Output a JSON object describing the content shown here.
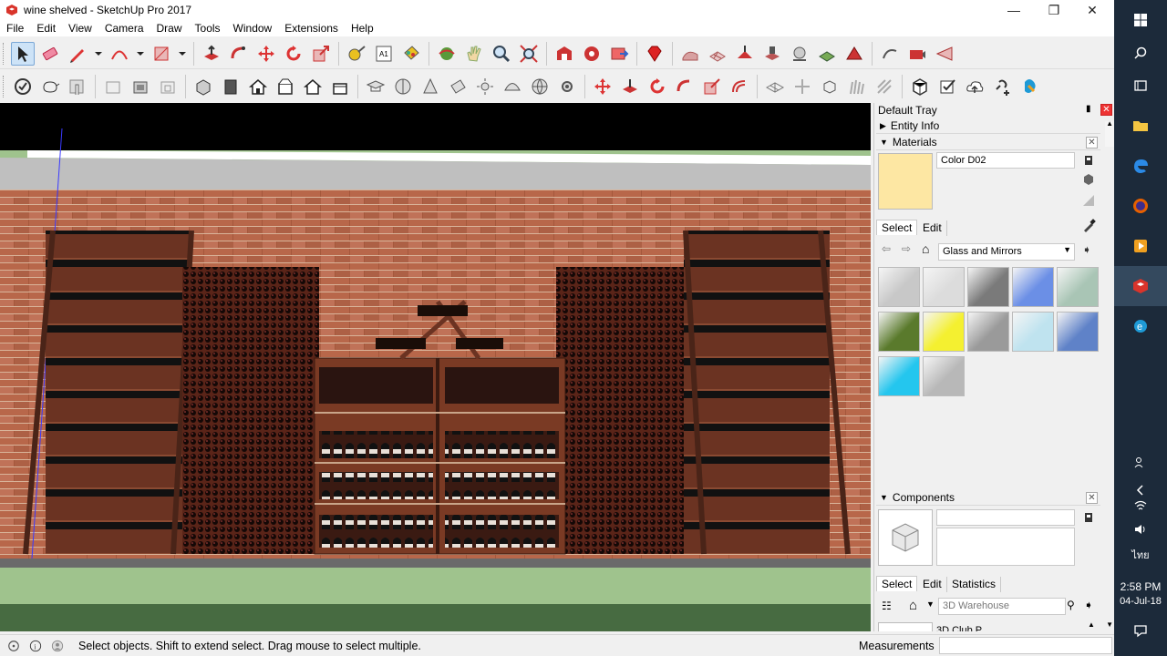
{
  "window": {
    "title": "wine shelved - SketchUp Pro 2017",
    "minimize_glyph": "—",
    "restore_glyph": "❐",
    "close_glyph": "✕"
  },
  "menu": [
    "File",
    "Edit",
    "View",
    "Camera",
    "Draw",
    "Tools",
    "Window",
    "Extensions",
    "Help"
  ],
  "tray": {
    "title": "Default Tray",
    "pin_glyph": "📌",
    "entity_info": {
      "label": "Entity Info"
    },
    "materials": {
      "label": "Materials",
      "material_name": "Color D02",
      "preview_color": "#fde7a3",
      "tabs": [
        "Select",
        "Edit"
      ],
      "library": "Glass and Mirrors",
      "swatches": [
        {
          "name": "swatch-mirror-1",
          "color": "#c8c8c8"
        },
        {
          "name": "swatch-mirror-2",
          "color": "#dcdcdc"
        },
        {
          "name": "swatch-glass-block",
          "color": "#7a7a7a"
        },
        {
          "name": "swatch-blue-glass",
          "color": "#6b8fe6"
        },
        {
          "name": "swatch-green-glass",
          "color": "#a9c5b5"
        },
        {
          "name": "swatch-dark-green",
          "color": "#5a7a2c"
        },
        {
          "name": "swatch-yellow",
          "color": "#f4f030"
        },
        {
          "name": "swatch-grey-mirror",
          "color": "#9a9a9a"
        },
        {
          "name": "swatch-diamond-glass",
          "color": "#bfe3ef"
        },
        {
          "name": "swatch-sky-reflect",
          "color": "#5f82c8"
        },
        {
          "name": "swatch-cyan",
          "color": "#24c6ee"
        },
        {
          "name": "swatch-speckle",
          "color": "#b8b8b8"
        }
      ]
    },
    "components": {
      "label": "Components",
      "tabs": [
        "Select",
        "Edit",
        "Statistics"
      ],
      "search_placeholder": "3D Warehouse",
      "partial_text": "3D Club P..."
    }
  },
  "status": {
    "message": "Select objects. Shift to extend select. Drag mouse to select multiple.",
    "measurements_label": "Measurements",
    "measurements_value": ""
  },
  "taskbar": {
    "time": "2:58 PM",
    "date": "04-Jul-18",
    "lang": "ไทย"
  }
}
